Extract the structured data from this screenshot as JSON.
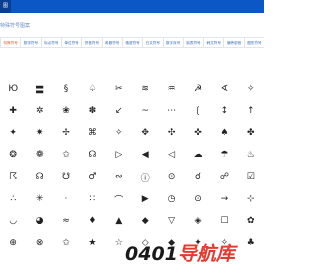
{
  "header": {
    "nav_tab": "图",
    "subtitle": "特殊符号图案"
  },
  "tabs": [
    {
      "label": "特殊符号",
      "active": true
    },
    {
      "label": "数学符号",
      "active": false
    },
    {
      "label": "标点符号",
      "active": false
    },
    {
      "label": "单位符号",
      "active": false
    },
    {
      "label": "拼音符号",
      "active": false
    },
    {
      "label": "希腊符号",
      "active": false
    },
    {
      "label": "俄语符号",
      "active": false
    },
    {
      "label": "日文符号",
      "active": false
    },
    {
      "label": "数字序号",
      "active": false
    },
    {
      "label": "制表符号",
      "active": false
    },
    {
      "label": "韩文符号",
      "active": false
    },
    {
      "label": "偏旁部首",
      "active": false
    },
    {
      "label": "图形符号",
      "active": false
    }
  ],
  "symbols": [
    "Ю",
    "〓",
    "§",
    "♤",
    "✂",
    "≋",
    "♒",
    "☭",
    "∢",
    "✧",
    "✚",
    "✲",
    "❀",
    "✽",
    "↙",
    "~",
    "⋯",
    "❲",
    "↕",
    "↑",
    "✦",
    "✷",
    "✢",
    "⌘",
    "✧",
    "✥",
    "✣",
    "✜",
    "♠",
    "✤",
    "❂",
    "❁",
    "✩",
    "☊",
    "▷",
    "◀",
    "◁",
    "☁",
    "☂",
    "♨",
    "☈",
    "☊",
    "☋",
    "♂",
    "∾",
    "ⓘ",
    "⊙",
    "☌",
    "☍",
    "☑",
    "∴",
    "✳",
    "·",
    "∷",
    "⌒",
    "▶",
    "◷",
    "⊙",
    "→",
    "⊹",
    "◡",
    "◕",
    "≈",
    "♦",
    "▲",
    "◆",
    "▽",
    "◈",
    "☐",
    "✿",
    "⊕",
    "⊗",
    "✩",
    "★",
    "☆",
    "◇",
    "◆",
    "✦",
    "✧",
    "♣"
  ],
  "watermark": {
    "text_dark": "0401",
    "text_red": "导航库"
  }
}
